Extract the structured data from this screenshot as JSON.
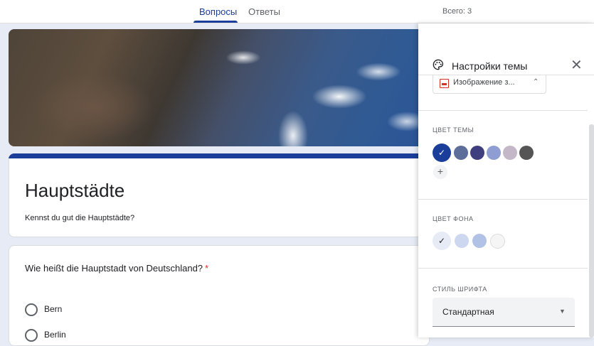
{
  "tabs": [
    {
      "label": "Вопросы",
      "active": true
    },
    {
      "label": "Ответы",
      "active": false
    }
  ],
  "total": "Всего: 3",
  "form": {
    "title": "Hauptstädte",
    "description": "Kennst du gut die Hauptstädte?"
  },
  "question": {
    "text": "Wie heißt die Hauptstadt von Deutschland?",
    "required_mark": "*",
    "options": [
      {
        "label": "Bern"
      },
      {
        "label": "Berlin"
      }
    ]
  },
  "theme_panel": {
    "title": "Настройки темы",
    "header_image_chip": "Изображение з...",
    "theme_color_label": "ЦВЕТ ТЕМЫ",
    "theme_colors": [
      "#1a3e9a",
      "#5c6e99",
      "#3f3e7e",
      "#8f9ed2",
      "#c4b8c8",
      "#555555"
    ],
    "theme_selected": 0,
    "add_color_symbol": "+",
    "background_color_label": "ЦВЕТ ФОНА",
    "background_colors": [
      "#e6ebf5",
      "#cdd8f0",
      "#b1c2e6",
      "#f5f5f5"
    ],
    "background_selected": 0,
    "font_style_label": "СТИЛЬ ШРИФТА",
    "font_style_value": "Стандартная"
  },
  "colors": {
    "accent": "#1a3e9a",
    "page_background": "#e6ebf5",
    "required": "#d93025"
  }
}
